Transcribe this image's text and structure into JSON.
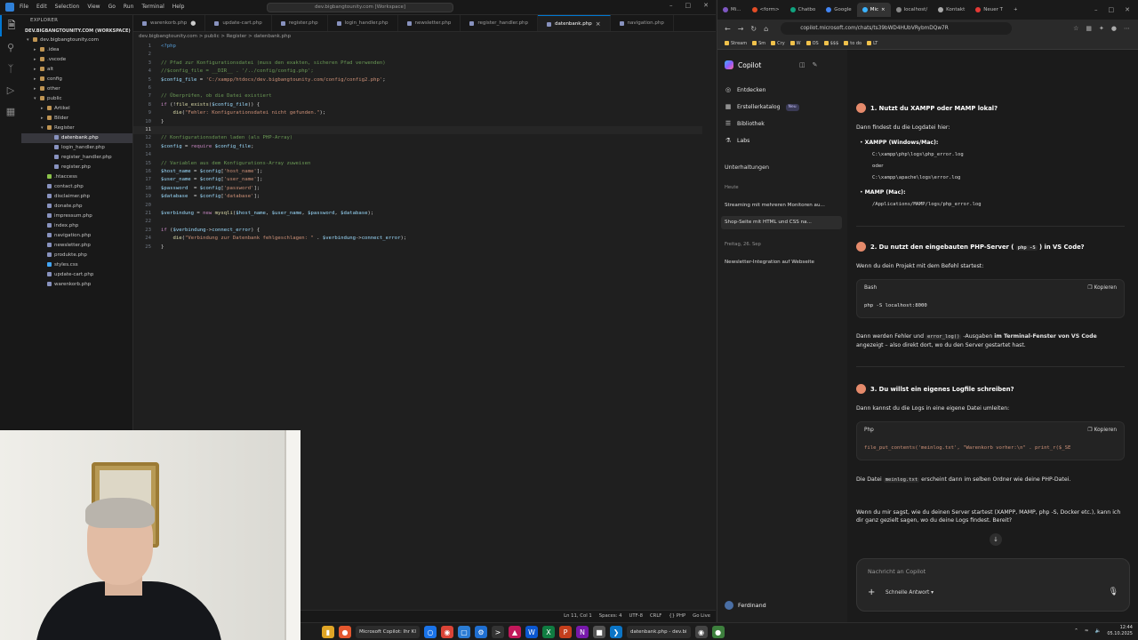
{
  "vscode": {
    "menu": [
      "File",
      "Edit",
      "Selection",
      "View",
      "Go",
      "Run",
      "Terminal",
      "Help"
    ],
    "command_center": "dev.bigbangtounity.com [Workspace]",
    "explorer_title": "EXPLORER",
    "workspace_root": "DEV.BIGBANGTOUNITY.COM (WORKSPACE)",
    "tree": [
      {
        "label": "dev.bigbangtounity.com",
        "depth": 0,
        "type": "folder",
        "open": true
      },
      {
        "label": ".idea",
        "depth": 1,
        "type": "folder"
      },
      {
        "label": ".vscode",
        "depth": 1,
        "type": "folder"
      },
      {
        "label": "alt",
        "depth": 1,
        "type": "folder"
      },
      {
        "label": "config",
        "depth": 1,
        "type": "folder"
      },
      {
        "label": "other",
        "depth": 1,
        "type": "folder"
      },
      {
        "label": "public",
        "depth": 1,
        "type": "folder",
        "open": true
      },
      {
        "label": "Artikel",
        "depth": 2,
        "type": "folder"
      },
      {
        "label": "Bilder",
        "depth": 2,
        "type": "folder"
      },
      {
        "label": "Register",
        "depth": 2,
        "type": "folder",
        "open": true
      },
      {
        "label": "datenbank.php",
        "depth": 3,
        "type": "php",
        "selected": true
      },
      {
        "label": "login_handler.php",
        "depth": 3,
        "type": "php"
      },
      {
        "label": "register_handler.php",
        "depth": 3,
        "type": "php"
      },
      {
        "label": "register.php",
        "depth": 3,
        "type": "php"
      },
      {
        "label": ".htaccess",
        "depth": 2,
        "type": "ht"
      },
      {
        "label": "contact.php",
        "depth": 2,
        "type": "php"
      },
      {
        "label": "disclaimer.php",
        "depth": 2,
        "type": "php"
      },
      {
        "label": "donate.php",
        "depth": 2,
        "type": "php"
      },
      {
        "label": "impressum.php",
        "depth": 2,
        "type": "php"
      },
      {
        "label": "index.php",
        "depth": 2,
        "type": "php"
      },
      {
        "label": "navigation.php",
        "depth": 2,
        "type": "php"
      },
      {
        "label": "newsletter.php",
        "depth": 2,
        "type": "php"
      },
      {
        "label": "produkte.php",
        "depth": 2,
        "type": "php"
      },
      {
        "label": "styles.css",
        "depth": 2,
        "type": "css"
      },
      {
        "label": "update-cart.php",
        "depth": 2,
        "type": "php"
      },
      {
        "label": "warenkorb.php",
        "depth": 2,
        "type": "php"
      }
    ],
    "tabs": [
      {
        "label": "warenkorb.php",
        "modified": true,
        "active": false
      },
      {
        "label": "update-cart.php",
        "modified": false,
        "active": false
      },
      {
        "label": "register.php",
        "modified": false,
        "active": false
      },
      {
        "label": "login_handler.php",
        "modified": false,
        "active": false
      },
      {
        "label": "newsletter.php",
        "modified": false,
        "active": false
      },
      {
        "label": "register_handler.php",
        "modified": false,
        "active": false
      },
      {
        "label": "datenbank.php",
        "modified": false,
        "active": true
      },
      {
        "label": "navigation.php",
        "modified": false,
        "active": false
      }
    ],
    "breadcrumb": "dev.bigbangtounity.com > public > Register > datenbank.php",
    "code_lines": [
      [
        [
          "tag",
          "<?php"
        ]
      ],
      [],
      [
        [
          "com",
          "// Pfad zur Konfigurationsdatei (muss den exakten, sicheren Pfad verwenden)"
        ]
      ],
      [
        [
          "com",
          "//$config_file = __DIR__ . '/../config/config.php';"
        ]
      ],
      [
        [
          "var",
          "$config_file"
        ],
        [
          "pl",
          " = "
        ],
        [
          "str",
          "'C:/xampp/htdocs/dev.bigbangtounity.com/config/config2.php'"
        ],
        [
          "pl",
          ";"
        ]
      ],
      [],
      [
        [
          "com",
          "// Überprüfen, ob die Datei existiert"
        ]
      ],
      [
        [
          "kw",
          "if"
        ],
        [
          "pl",
          " (!"
        ],
        [
          "fn",
          "file_exists"
        ],
        [
          "pl",
          "("
        ],
        [
          "var",
          "$config_file"
        ],
        [
          "pl",
          ")) {"
        ]
      ],
      [
        [
          "pl",
          "    "
        ],
        [
          "fn",
          "die"
        ],
        [
          "pl",
          "("
        ],
        [
          "str",
          "\"Fehler: Konfigurationsdatei nicht gefunden.\""
        ],
        [
          "pl",
          ");"
        ]
      ],
      [
        [
          "pl",
          "}"
        ]
      ],
      [],
      [
        [
          "com",
          "// Konfigurationsdaten laden (als PHP-Array)"
        ]
      ],
      [
        [
          "var",
          "$config"
        ],
        [
          "pl",
          " = "
        ],
        [
          "kw",
          "require"
        ],
        [
          "pl",
          " "
        ],
        [
          "var",
          "$config_file"
        ],
        [
          "pl",
          ";"
        ]
      ],
      [],
      [
        [
          "com",
          "// Variablen aus dem Konfigurations-Array zuweisen"
        ]
      ],
      [
        [
          "var",
          "$host_name"
        ],
        [
          "pl",
          " = "
        ],
        [
          "var",
          "$config"
        ],
        [
          "pl",
          "["
        ],
        [
          "str",
          "'host_name'"
        ],
        [
          "pl",
          "];"
        ]
      ],
      [
        [
          "var",
          "$user_name"
        ],
        [
          "pl",
          " = "
        ],
        [
          "var",
          "$config"
        ],
        [
          "pl",
          "["
        ],
        [
          "str",
          "'user_name'"
        ],
        [
          "pl",
          "];"
        ]
      ],
      [
        [
          "var",
          "$password"
        ],
        [
          "pl",
          "  = "
        ],
        [
          "var",
          "$config"
        ],
        [
          "pl",
          "["
        ],
        [
          "str",
          "'password'"
        ],
        [
          "pl",
          "];"
        ]
      ],
      [
        [
          "var",
          "$database"
        ],
        [
          "pl",
          "  = "
        ],
        [
          "var",
          "$config"
        ],
        [
          "pl",
          "["
        ],
        [
          "str",
          "'database'"
        ],
        [
          "pl",
          "];"
        ]
      ],
      [],
      [
        [
          "var",
          "$verbindung"
        ],
        [
          "pl",
          " = "
        ],
        [
          "kw",
          "new"
        ],
        [
          "pl",
          " "
        ],
        [
          "fn",
          "mysqli"
        ],
        [
          "pl",
          "("
        ],
        [
          "var",
          "$host_name"
        ],
        [
          "pl",
          ", "
        ],
        [
          "var",
          "$user_name"
        ],
        [
          "pl",
          ", "
        ],
        [
          "var",
          "$password"
        ],
        [
          "pl",
          ", "
        ],
        [
          "var",
          "$database"
        ],
        [
          "pl",
          ");"
        ]
      ],
      [],
      [
        [
          "kw",
          "if"
        ],
        [
          "pl",
          " ("
        ],
        [
          "var",
          "$verbindung"
        ],
        [
          "pl",
          "->"
        ],
        [
          "var",
          "connect_error"
        ],
        [
          "pl",
          ") {"
        ]
      ],
      [
        [
          "pl",
          "    "
        ],
        [
          "fn",
          "die"
        ],
        [
          "pl",
          "("
        ],
        [
          "str",
          "\"Verbindung zur Datenbank fehlgeschlagen: \""
        ],
        [
          "pl",
          " . "
        ],
        [
          "var",
          "$verbindung"
        ],
        [
          "pl",
          "->"
        ],
        [
          "var",
          "connect_error"
        ],
        [
          "pl",
          ");"
        ]
      ],
      [
        [
          "pl",
          "}"
        ]
      ]
    ],
    "current_line": 11,
    "status": [
      "Ln 11, Col 1",
      "Spaces: 4",
      "UTF-8",
      "CRLF",
      "{} PHP",
      "Go Live"
    ]
  },
  "taskbar": {
    "apps": [
      {
        "label": "Microsoft Copilot: Ihr KI"
      },
      {
        "label": "datenbank.php - dev.bi"
      }
    ],
    "time": "12:44",
    "date": "05.10.2025"
  },
  "browser": {
    "tabs": [
      {
        "label": "Mi..."
      },
      {
        "label": "<form>"
      },
      {
        "label": "Chatbo"
      },
      {
        "label": "Google"
      },
      {
        "label": "Mic",
        "active": true
      },
      {
        "label": "localhost/"
      },
      {
        "label": "Kontakt"
      },
      {
        "label": "Neuer T"
      }
    ],
    "url": "copilot.microsoft.com/chats/ts39bWD4HUbVRybmDQw7R",
    "favorites": [
      "Stream",
      "Sm",
      "Cry",
      "W",
      "OS",
      "$$$",
      "to do",
      "LT"
    ],
    "copilot": {
      "brand": "Copilot",
      "nav": [
        {
          "label": "Entdecken",
          "icon": "compass-icon"
        },
        {
          "label": "Erstellerkatalog",
          "icon": "grid-icon",
          "badge": "Neu"
        },
        {
          "label": "Bibliothek",
          "icon": "library-icon"
        },
        {
          "label": "Labs",
          "icon": "flask-icon"
        }
      ],
      "conversations_title": "Unterhaltungen",
      "group_today": "Heute",
      "conversations_today": [
        "Streaming mit mehreren Monitoren au...",
        "Shop-Seite mit HTML und CSS na..."
      ],
      "group_date": "Freitag, 26. Sep",
      "conversations_older": [
        "Newsletter-Integration auf Webseite"
      ],
      "user": "Ferdinand",
      "chat": {
        "h1": "1. Nutzt du XAMPP oder MAMP lokal?",
        "p1": "Dann findest du die Logdatei hier:",
        "xampp_label": "XAMPP (Windows/Mac):",
        "xampp_path1": "C:\\xampp\\php\\logs\\php_error.log",
        "oder": "oder",
        "xampp_path2": "C:\\xampp\\apache\\logs\\error.log",
        "mamp_label": "MAMP (Mac):",
        "mamp_path": "/Applications/MAMP/logs/php_error.log",
        "h2_a": "2. Du nutzt den eingebauten PHP-Server (",
        "h2_code": "php -S",
        "h2_b": ") in VS Code?",
        "p2": "Wenn du dein Projekt mit dem Befehl startest:",
        "code1_lang": "Bash",
        "copy": "Kopieren",
        "code1": "php -S localhost:8000",
        "p3_a": "Dann werden Fehler und",
        "p3_code": "error_log()",
        "p3_b": "-Ausgaben",
        "p3_bold": "im Terminal-Fenster von VS Code",
        "p3_c": "angezeigt – also direkt dort, wo du den Server gestartet hast.",
        "h3": "3. Du willst ein eigenes Logfile schreiben?",
        "p4": "Dann kannst du die Logs in eine eigene Datei umleiten:",
        "code2_lang": "Php",
        "code2": "file_put_contents('meinlog.txt', \"Warenkorb vorher:\\n\" . print_r($_SE",
        "p5_a": "Die Datei",
        "p5_code": "meinlog.txt",
        "p5_b": "erscheint dann im selben Ordner wie deine PHP-Datei.",
        "p6": "Wenn du mir sagst, wie du deinen Server startest (XAMPP, MAMP, php -S, Docker etc.), kann ich dir ganz gezielt sagen, wo du deine Logs findest. Bereit?"
      },
      "input_placeholder": "Nachricht an Copilot",
      "mode": "Schnelle Antwort"
    }
  }
}
